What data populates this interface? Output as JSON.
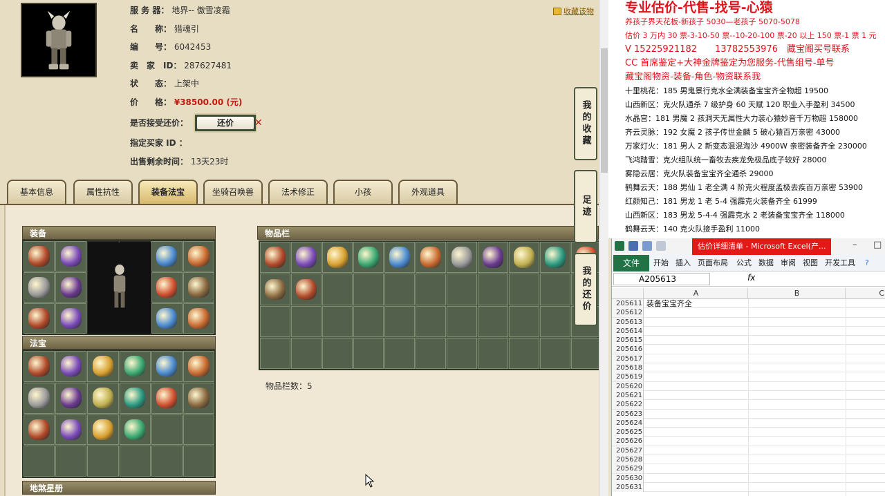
{
  "info": {
    "server_label": "服 务 器：",
    "server_value": "地界-- 傲雪凌霜",
    "name_label": "名　　称：",
    "name_value": "猎魂引",
    "number_label": "编　　号：",
    "number_value": "6042453",
    "seller_label": "卖　家　ID：",
    "seller_value": "287627481",
    "status_label": "状　　态：",
    "status_value": "上架中",
    "price_label": "价　　格：",
    "price_value": "¥38500.00 (元)",
    "bargain_label": "是否接受还价：",
    "bargain_button": "还价",
    "buyer_label": "指定买家 ID ：",
    "time_label": "出售剩余时间：",
    "time_value": "13天23时"
  },
  "favorite_link": "收藏该物",
  "tabs": [
    "基本信息",
    "属性抗性",
    "装备法宝",
    "坐骑召唤兽",
    "法术修正",
    "小孩",
    "外观道具"
  ],
  "active_tab": "装备法宝",
  "panels": {
    "equipment": "装备",
    "treasure": "法宝",
    "bag": "物品栏",
    "earth_book": "地煞星册"
  },
  "bag_count": "物品栏数：5",
  "side_tabs": [
    "我的收藏",
    "足迹",
    "我的还价"
  ],
  "doc": {
    "headline": "专业估价-代售-找号-心猿",
    "lines": [
      {
        "text": "养孩子界天花板-新孩子 5030—老孩子 5070-5078",
        "style": "red"
      },
      {
        "text": "估价 3 万内 30 票-3-10-50 票--10-20-100 票-20 以上 150 票-1 票 1 元",
        "style": "red"
      },
      {
        "text": "V 15225921182　　13782553976　藏宝阁买号联系",
        "style": "red-big"
      },
      {
        "text": "CC 首席鉴定+大神金牌鉴定为您服务-代售组号-单号",
        "style": "red-big"
      },
      {
        "text": "藏宝阁物资-装备-角色-物资联系我",
        "style": "red-big"
      },
      {
        "text": "十里桃花：185 男鬼景行克水全满装备宝宝齐全物超 19500",
        "style": "normal"
      },
      {
        "text": "山西新区：克火队通杀 7 级护身 60 天赋 120 职业入手盈利 34500",
        "style": "normal"
      },
      {
        "text": "水晶宫：181 男魔 2 孩洞天无属性大力装心猿妙音千万物超 158000",
        "style": "normal"
      },
      {
        "text": "齐云灵脉：192 女魔 2 孩子传世金麟 5 破心猿百万亲密 43000",
        "style": "normal"
      },
      {
        "text": "万家灯火：181 男人 2 新变态混混淘沙 4900W 亲密装备齐全 230000",
        "style": "normal"
      },
      {
        "text": "飞鸿踏雪：克火组队统一畜牧去疾龙免极品底子较好 28000",
        "style": "normal"
      },
      {
        "text": "雾隐云居：克火队装备宝宝齐全通杀 29000",
        "style": "normal"
      },
      {
        "text": "鹤舞云天：188 男仙 1 老全满 4 阶克火程度孟极去疾百万亲密 53900",
        "style": "normal"
      },
      {
        "text": "红颜知己：181 男龙 1 老 5-4 强霹克火装备齐全 61999",
        "style": "normal"
      },
      {
        "text": "山西新区：183 男龙 5-4-4 强霹克水 2 老装备宝宝齐全 118000",
        "style": "normal"
      },
      {
        "text": "鹤舞云天：140 克火队接手盈利 11000",
        "style": "normal"
      }
    ]
  },
  "excel": {
    "title": "估价详细清单 - Microsoft Excel(产...",
    "file_tab": "文件",
    "ribbon_tabs": [
      "开始",
      "插入",
      "页面布局",
      "公式",
      "数据",
      "审阅",
      "视图",
      "开发工具"
    ],
    "namebox": "A205613",
    "fx": "fx",
    "columns": [
      "A",
      "B",
      "C"
    ],
    "rows": [
      {
        "num": "205611",
        "a": "装备宝宝齐全"
      },
      {
        "num": "205612",
        "a": ""
      },
      {
        "num": "205613",
        "a": ""
      },
      {
        "num": "205614",
        "a": ""
      },
      {
        "num": "205615",
        "a": ""
      },
      {
        "num": "205616",
        "a": ""
      },
      {
        "num": "205617",
        "a": ""
      },
      {
        "num": "205618",
        "a": ""
      },
      {
        "num": "205619",
        "a": ""
      },
      {
        "num": "205620",
        "a": ""
      },
      {
        "num": "205621",
        "a": ""
      },
      {
        "num": "205622",
        "a": ""
      },
      {
        "num": "205623",
        "a": ""
      },
      {
        "num": "205624",
        "a": ""
      },
      {
        "num": "205625",
        "a": ""
      },
      {
        "num": "205626",
        "a": ""
      },
      {
        "num": "205627",
        "a": ""
      },
      {
        "num": "205628",
        "a": ""
      },
      {
        "num": "205629",
        "a": ""
      },
      {
        "num": "205630",
        "a": ""
      },
      {
        "num": "205631",
        "a": ""
      }
    ]
  },
  "equip_items": [
    "armor-icon",
    "helmet-icon",
    "",
    "",
    "mask-icon",
    "necklace-icon",
    "spear-icon",
    "robe-icon",
    "",
    "",
    "ring-icon",
    "ring-icon",
    "amulet-icon",
    "boots-icon",
    "",
    "",
    "bracelet-icon",
    "orb-icon"
  ],
  "treasure_items": [
    "cage-icon",
    "talisman-icon",
    "flute-icon",
    "lantern-icon",
    "mirror-icon",
    "claw-icon",
    "book-icon",
    "whip-icon",
    "scroll-icon",
    "bell-icon",
    "cloud-icon",
    "seal-icon",
    "gauntlet-icon",
    "fan-icon",
    "chain-icon",
    "staff-icon",
    "",
    ""
  ],
  "bag_items": [
    "hero-icon",
    "hero-icon",
    "jade-icon",
    "mask-icon",
    "glove-icon",
    "pendant-icon",
    "boots-icon",
    "spirit-icon",
    "brush-icon",
    "gem-icon",
    "claw-icon",
    "jade-icon",
    "bowl-icon"
  ]
}
